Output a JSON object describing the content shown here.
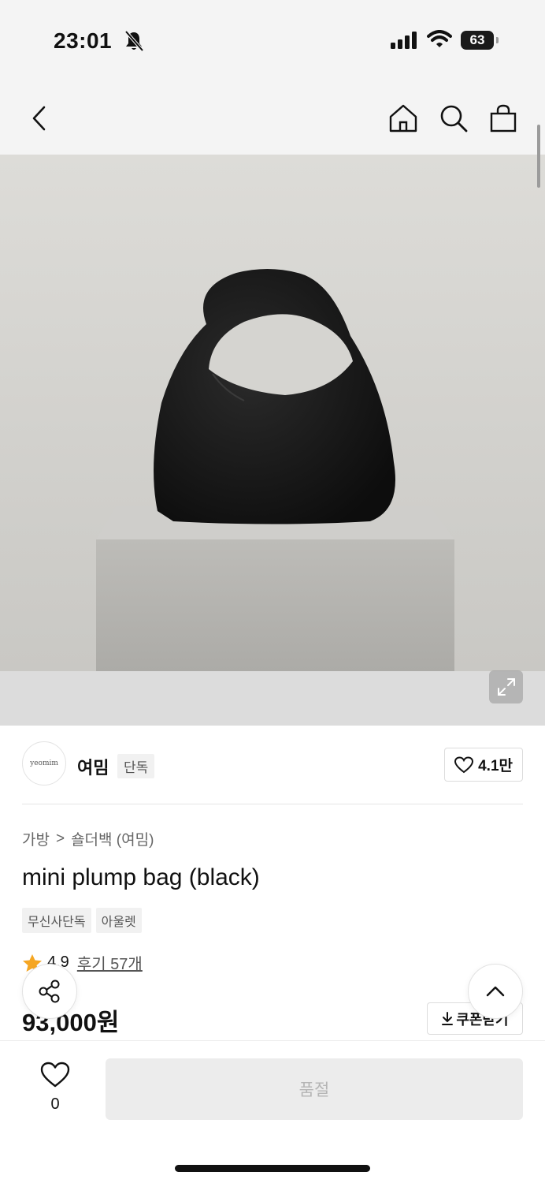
{
  "status_bar": {
    "time": "23:01",
    "battery": "63",
    "icons": [
      "bell-slash-icon",
      "cellular-signal-icon",
      "wifi-icon",
      "battery-icon"
    ]
  },
  "nav": {
    "icons": [
      "chevron-left-icon",
      "home-icon",
      "search-icon",
      "shopping-bag-icon"
    ]
  },
  "brand": {
    "logo_text": "yeomim",
    "name": "여밈",
    "badge": "단독",
    "like_count": "4.1만"
  },
  "breadcrumb": {
    "category": "가방",
    "separator": ">",
    "subcategory": "숄더백 (여밈)"
  },
  "product": {
    "title": "mini plump bag (black)",
    "tags": [
      "무신사단독",
      "아울렛"
    ],
    "rating": "4.9",
    "review_label": "후기 57개",
    "price": "93,000원",
    "coupon_label": "쿠폰받기"
  },
  "bottom_bar": {
    "wish_count": "0",
    "buy_label": "품절"
  },
  "colors": {
    "accent_star": "#f5a623",
    "disabled_button": "#ececec",
    "disabled_text": "#b5b5b5"
  }
}
